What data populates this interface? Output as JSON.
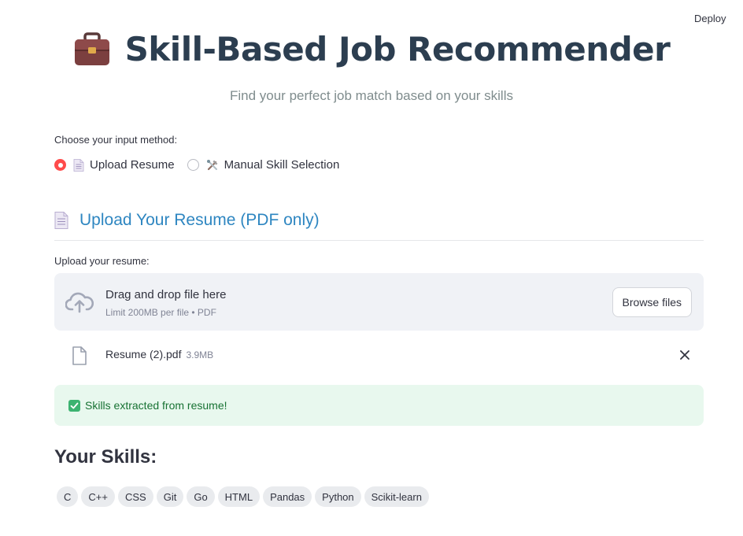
{
  "header": {
    "deploy_label": "Deploy"
  },
  "title": {
    "icon": "briefcase-icon",
    "text": "Skill-Based Job Recommender"
  },
  "subtitle": "Find your perfect job match based on your skills",
  "input_method": {
    "label": "Choose your input method:",
    "options": [
      {
        "icon": "document-icon",
        "label": "Upload Resume",
        "selected": true
      },
      {
        "icon": "tools-icon",
        "label": "Manual Skill Selection",
        "selected": false
      }
    ]
  },
  "upload_section": {
    "icon": "document-icon",
    "title": "Upload Your Resume (PDF only)",
    "field_label": "Upload your resume:",
    "dropzone_title": "Drag and drop file here",
    "dropzone_sub": "Limit 200MB per file • PDF",
    "browse_label": "Browse files",
    "file": {
      "name": "Resume (2).pdf",
      "size": "3.9MB"
    }
  },
  "success_message": "Skills extracted from resume!",
  "skills_heading": "Your Skills:",
  "skills": [
    "C",
    "C++",
    "CSS",
    "Git",
    "Go",
    "HTML",
    "Pandas",
    "Python",
    "Scikit-learn"
  ],
  "colors": {
    "accent": "#ff4b4b",
    "title": "#2c3e50",
    "section_title": "#2e86c1",
    "success_bg": "#e8f8ee",
    "success_text": "#177233"
  }
}
